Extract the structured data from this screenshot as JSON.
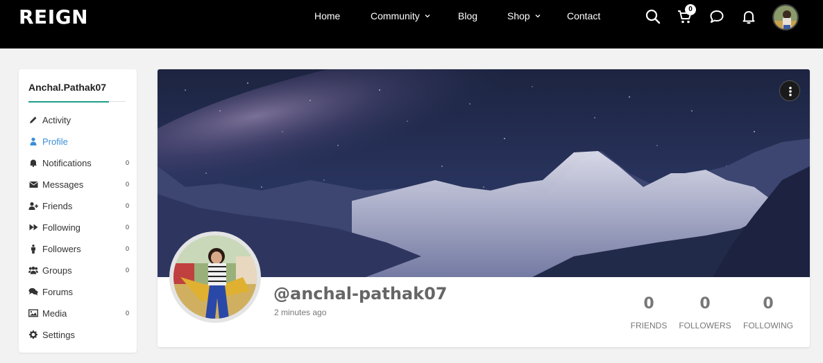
{
  "header": {
    "logo": "REIGN",
    "nav": [
      {
        "label": "Home",
        "has_dropdown": false
      },
      {
        "label": "Community",
        "has_dropdown": true
      },
      {
        "label": "Blog",
        "has_dropdown": false
      },
      {
        "label": "Shop",
        "has_dropdown": true
      },
      {
        "label": "Contact",
        "has_dropdown": false
      }
    ],
    "cart_count": "0"
  },
  "sidebar": {
    "username": "Anchal.Pathak07",
    "items": [
      {
        "label": "Activity",
        "icon": "pencil-icon",
        "count": ""
      },
      {
        "label": "Profile",
        "icon": "user-icon",
        "count": "",
        "active": true
      },
      {
        "label": "Notifications",
        "icon": "bell-icon",
        "count": "0"
      },
      {
        "label": "Messages",
        "icon": "envelope-icon",
        "count": "0"
      },
      {
        "label": "Friends",
        "icon": "user-plus-icon",
        "count": "0"
      },
      {
        "label": "Following",
        "icon": "fast-forward-icon",
        "count": "0"
      },
      {
        "label": "Followers",
        "icon": "person-icon",
        "count": "0"
      },
      {
        "label": "Groups",
        "icon": "users-icon",
        "count": "0"
      },
      {
        "label": "Forums",
        "icon": "comments-icon",
        "count": ""
      },
      {
        "label": "Media",
        "icon": "image-icon",
        "count": "0"
      },
      {
        "label": "Settings",
        "icon": "gear-icon",
        "count": ""
      }
    ]
  },
  "profile": {
    "handle": "@anchal-pathak07",
    "last_active": "2 minutes ago",
    "stats": [
      {
        "value": "0",
        "label": "FRIENDS"
      },
      {
        "value": "0",
        "label": "FOLLOWERS"
      },
      {
        "value": "0",
        "label": "FOLLOWING"
      }
    ]
  },
  "colors": {
    "header_bg": "#000000",
    "accent_teal": "#1e9e8a",
    "active_blue": "#3a8fd8",
    "page_bg": "#f2f2f2"
  }
}
